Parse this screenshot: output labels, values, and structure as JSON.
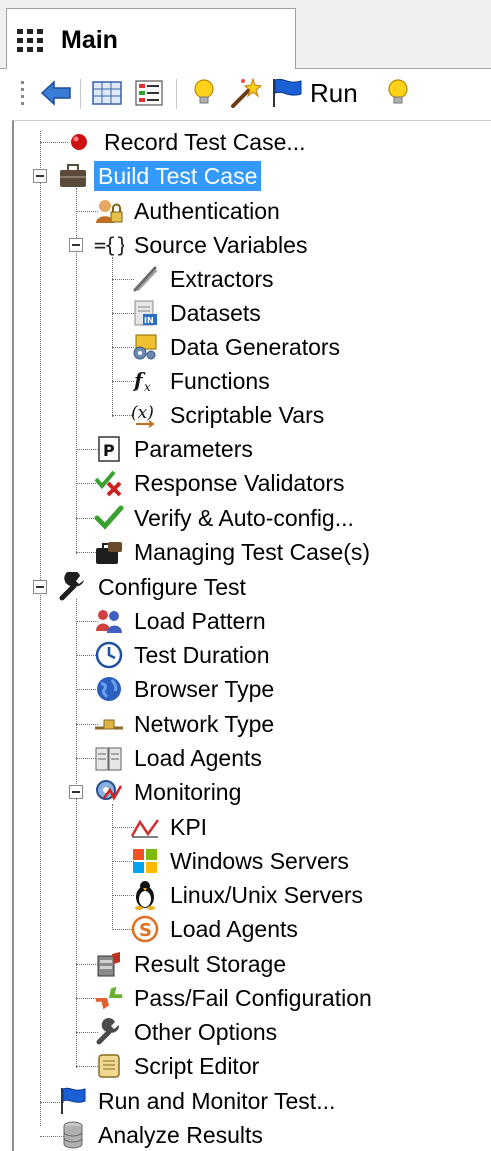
{
  "tab": {
    "label": "Main"
  },
  "toolbar": {
    "run_label": "Run"
  },
  "tree": {
    "record": "Record Test Case...",
    "build": "Build Test Case",
    "authentication": "Authentication",
    "source_variables": "Source Variables",
    "extractors": "Extractors",
    "datasets": "Datasets",
    "data_generators": "Data Generators",
    "functions": "Functions",
    "scriptable_vars": "Scriptable Vars",
    "parameters": "Parameters",
    "response_validators": "Response Validators",
    "verify": "Verify & Auto-config...",
    "managing": "Managing Test Case(s)",
    "configure": "Configure Test",
    "load_pattern": "Load Pattern",
    "test_duration": "Test Duration",
    "browser_type": "Browser Type",
    "network_type": "Network Type",
    "load_agents": "Load Agents",
    "monitoring": "Monitoring",
    "kpi": "KPI",
    "windows_servers": "Windows Servers",
    "linux_servers": "Linux/Unix Servers",
    "monitor_load_agents": "Load Agents",
    "result_storage": "Result Storage",
    "passfail": "Pass/Fail Configuration",
    "other_options": "Other Options",
    "script_editor": "Script Editor",
    "run_monitor": "Run and Monitor Test...",
    "analyze": "Analyze Results"
  },
  "colors": {
    "selection": "#3399ff",
    "record_dot": "#cc1111",
    "flag_blue": "#1a5fd6"
  }
}
